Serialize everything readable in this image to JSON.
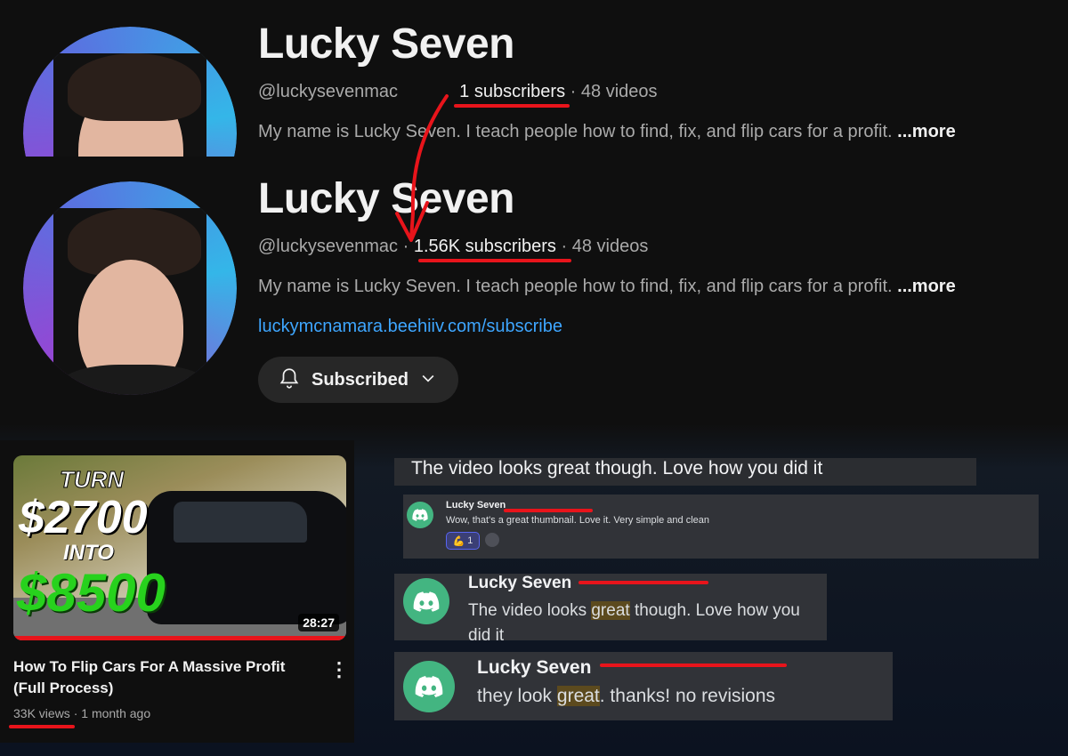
{
  "channel_before": {
    "name": "Lucky Seven",
    "handle": "@luckysevenmac",
    "subscribers": "1 subscribers",
    "videos": "48 videos",
    "description": "My name is Lucky Seven. I teach people how to find, fix, and flip cars for a profit.",
    "more": "...more"
  },
  "channel_after": {
    "name": "Lucky Seven",
    "handle": "@luckysevenmac",
    "subscribers": "1.56K subscribers",
    "videos": "48 videos",
    "description": "My name is Lucky Seven. I teach people how to find, fix, and flip cars for a profit.",
    "more": "...more",
    "link": "luckymcnamara.beehiiv.com/subscribe",
    "subscribe_label": "Subscribed"
  },
  "separator": "·",
  "video": {
    "thumb_turn": "TURN",
    "thumb_amount_from": "$2700",
    "thumb_into": "INTO",
    "thumb_amount_to": "$8500",
    "duration": "28:27",
    "title": "How To Flip Cars For A Massive Profit (Full Process)",
    "views": "33K views",
    "age": "1 month ago"
  },
  "discord": {
    "banner_text": "The video looks great though. Love how you did it",
    "msg1": {
      "author": "Lucky Seven",
      "text": "Wow, that's a great thumbnail. Love it. Very simple and clean",
      "reaction_count": "1"
    },
    "msg2": {
      "author": "Lucky Seven",
      "text_before": "The video looks ",
      "highlight": "great",
      "text_after": " though. Love how you did it"
    },
    "msg3": {
      "author": "Lucky Seven",
      "text_before": "they look ",
      "highlight": "great",
      "text_after": ". thanks! no revisions"
    }
  },
  "colors": {
    "annotation_red": "#e8141b",
    "link_blue": "#3ea6ff",
    "discord_green": "#43b581",
    "thumb_green": "#27d21d"
  },
  "icons": {
    "bell": "bell-icon",
    "chevron": "chevron-down-icon",
    "discord": "discord-logo-icon",
    "more": "more-vert-icon"
  }
}
